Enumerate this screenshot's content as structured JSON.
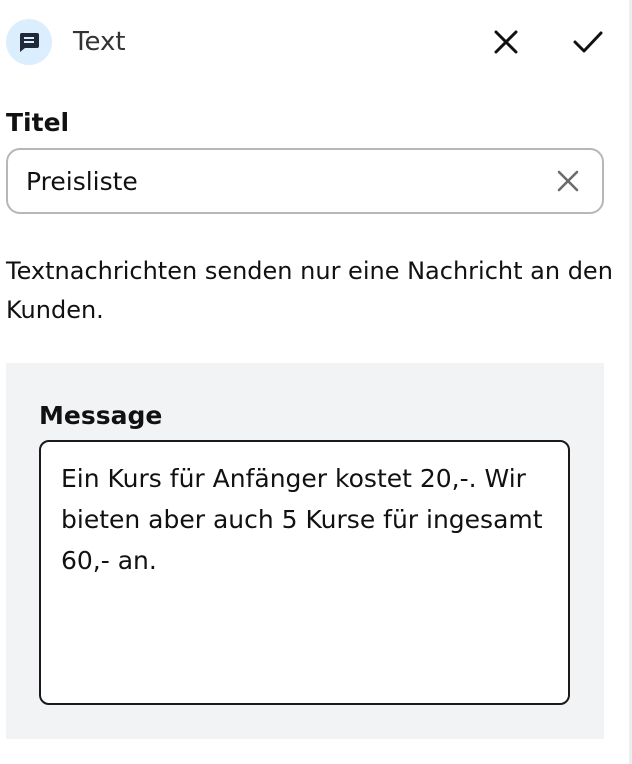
{
  "header": {
    "icon": "message-icon",
    "title": "Text",
    "close_icon": "close-icon",
    "confirm_icon": "check-icon"
  },
  "title_field": {
    "label": "Titel",
    "value": "Preisliste",
    "clear_icon": "close-icon"
  },
  "description": "Textnachrichten senden nur eine Nachricht an den Kunden.",
  "message": {
    "label": "Message",
    "value": "Ein Kurs für Anfänger kostet 20,-. Wir bieten aber auch 5 Kurse für ingesamt 60,- an."
  },
  "colors": {
    "icon_bg": "#dbeefe",
    "section_bg": "#f2f3f5",
    "input_border": "#b7b7b7"
  }
}
